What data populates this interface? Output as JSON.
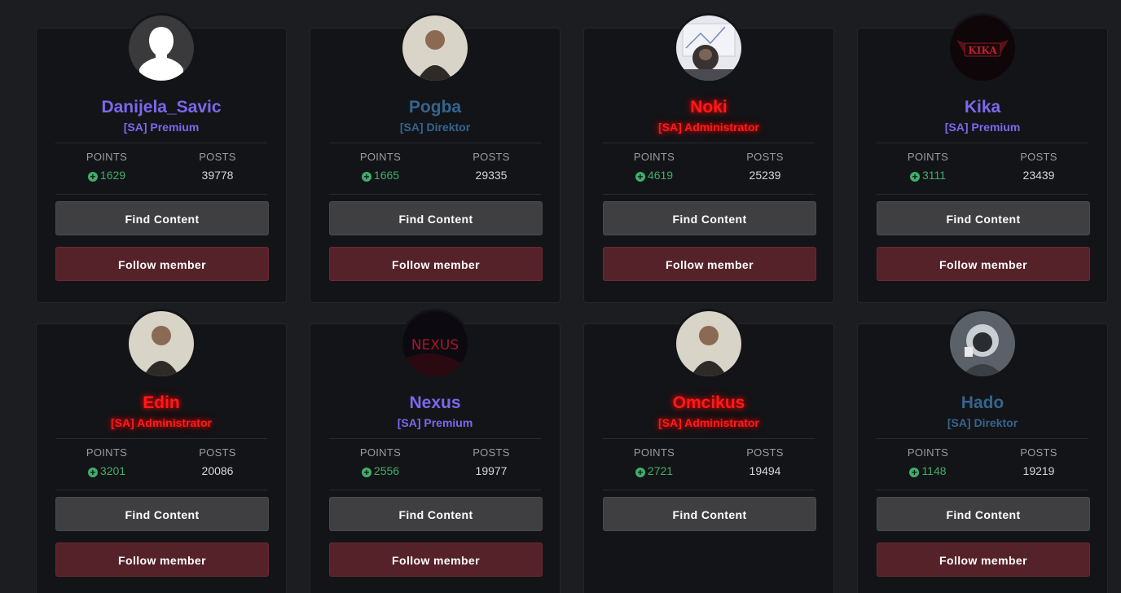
{
  "labels": {
    "points": "POINTS",
    "posts": "POSTS",
    "find_content": "Find Content",
    "follow_member": "Follow member"
  },
  "colors": {
    "premium": "#7b68ee",
    "direktor": "#34658f",
    "administrator": "#ff1a1a",
    "points_green": "#3fae6a"
  },
  "members": [
    {
      "name": "Danijela_Savic",
      "group": "[SA] Premium",
      "rank": "premium",
      "points": "1629",
      "posts": "39778",
      "avatar": "default-user-silhouette",
      "follow": true
    },
    {
      "name": "Pogba",
      "group": "[SA] Direktor",
      "rank": "direktor",
      "points": "1665",
      "posts": "29335",
      "avatar": "photo-person",
      "follow": true
    },
    {
      "name": "Noki",
      "group": "[SA] Administrator",
      "rank": "administrator",
      "points": "4619",
      "posts": "25239",
      "avatar": "photo-chimp-at-desk",
      "follow": true
    },
    {
      "name": "Kika",
      "group": "[SA] Premium",
      "rank": "premium",
      "points": "3111",
      "posts": "23439",
      "avatar": "red-logo-kika",
      "follow": true
    },
    {
      "name": "Edin",
      "group": "[SA] Administrator",
      "rank": "administrator",
      "points": "3201",
      "posts": "20086",
      "avatar": "photo-person",
      "follow": true
    },
    {
      "name": "Nexus",
      "group": "[SA] Premium",
      "rank": "premium",
      "points": "2556",
      "posts": "19977",
      "avatar": "red-logo-nexus",
      "follow": true
    },
    {
      "name": "Omcikus",
      "group": "[SA] Administrator",
      "rank": "administrator",
      "points": "2721",
      "posts": "19494",
      "avatar": "photo-person",
      "follow": false
    },
    {
      "name": "Hado",
      "group": "[SA] Direktor",
      "rank": "direktor",
      "points": "1148",
      "posts": "19219",
      "avatar": "photo-masked-person",
      "follow": true
    }
  ]
}
